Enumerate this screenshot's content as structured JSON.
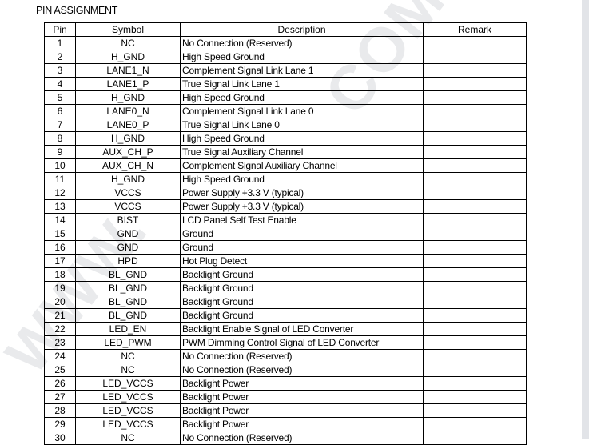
{
  "document": {
    "section_title": "PIN ASSIGNMENT",
    "watermark_left": "WWW.",
    "watermark_right": "COM"
  },
  "table": {
    "columns": [
      "Pin",
      "Symbol",
      "Description",
      "Remark"
    ],
    "rows": [
      {
        "pin": "1",
        "symbol": "NC",
        "description": "No Connection (Reserved)",
        "remark": ""
      },
      {
        "pin": "2",
        "symbol": "H_GND",
        "description": "High Speed Ground",
        "remark": ""
      },
      {
        "pin": "3",
        "symbol": "LANE1_N",
        "description": "Complement Signal Link Lane 1",
        "remark": ""
      },
      {
        "pin": "4",
        "symbol": "LANE1_P",
        "description": "True Signal Link Lane 1",
        "remark": ""
      },
      {
        "pin": "5",
        "symbol": "H_GND",
        "description": "High Speed Ground",
        "remark": ""
      },
      {
        "pin": "6",
        "symbol": "LANE0_N",
        "description": "Complement Signal Link Lane 0",
        "remark": ""
      },
      {
        "pin": "7",
        "symbol": "LANE0_P",
        "description": "True Signal Link Lane 0",
        "remark": ""
      },
      {
        "pin": "8",
        "symbol": "H_GND",
        "description": "High Speed Ground",
        "remark": ""
      },
      {
        "pin": "9",
        "symbol": "AUX_CH_P",
        "description": "True Signal Auxiliary Channel",
        "remark": ""
      },
      {
        "pin": "10",
        "symbol": "AUX_CH_N",
        "description": "Complement Signal Auxiliary Channel",
        "remark": ""
      },
      {
        "pin": "11",
        "symbol": "H_GND",
        "description": "High Speed Ground",
        "remark": ""
      },
      {
        "pin": "12",
        "symbol": "VCCS",
        "description": "Power Supply +3.3 V (typical)",
        "remark": ""
      },
      {
        "pin": "13",
        "symbol": "VCCS",
        "description": "Power Supply +3.3 V (typical)",
        "remark": ""
      },
      {
        "pin": "14",
        "symbol": "BIST",
        "description": "LCD Panel Self Test Enable",
        "remark": ""
      },
      {
        "pin": "15",
        "symbol": "GND",
        "description": "Ground",
        "remark": ""
      },
      {
        "pin": "16",
        "symbol": "GND",
        "description": "Ground",
        "remark": ""
      },
      {
        "pin": "17",
        "symbol": "HPD",
        "description": "Hot Plug Detect",
        "remark": ""
      },
      {
        "pin": "18",
        "symbol": "BL_GND",
        "description": "Backlight Ground",
        "remark": ""
      },
      {
        "pin": "19",
        "symbol": "BL_GND",
        "description": "Backlight Ground",
        "remark": ""
      },
      {
        "pin": "20",
        "symbol": "BL_GND",
        "description": "Backlight Ground",
        "remark": ""
      },
      {
        "pin": "21",
        "symbol": "BL_GND",
        "description": "Backlight Ground",
        "remark": ""
      },
      {
        "pin": "22",
        "symbol": "LED_EN",
        "description": "Backlight Enable Signal of LED Converter",
        "remark": ""
      },
      {
        "pin": "23",
        "symbol": "LED_PWM",
        "description": "PWM Dimming Control Signal of LED Converter",
        "remark": ""
      },
      {
        "pin": "24",
        "symbol": "NC",
        "description": "No Connection (Reserved)",
        "remark": ""
      },
      {
        "pin": "25",
        "symbol": "NC",
        "description": "No Connection (Reserved)",
        "remark": ""
      },
      {
        "pin": "26",
        "symbol": "LED_VCCS",
        "description": "Backlight Power",
        "remark": ""
      },
      {
        "pin": "27",
        "symbol": "LED_VCCS",
        "description": "Backlight Power",
        "remark": ""
      },
      {
        "pin": "28",
        "symbol": "LED_VCCS",
        "description": "Backlight Power",
        "remark": ""
      },
      {
        "pin": "29",
        "symbol": "LED_VCCS",
        "description": "Backlight Power",
        "remark": ""
      },
      {
        "pin": "30",
        "symbol": "NC",
        "description": "No Connection (Reserved)",
        "remark": ""
      }
    ]
  },
  "colors": {
    "text": "#000000",
    "border": "#000000",
    "page_background": "#ffffff",
    "watermark": "#e9eaec",
    "page_edge": "#e2e4e8"
  }
}
